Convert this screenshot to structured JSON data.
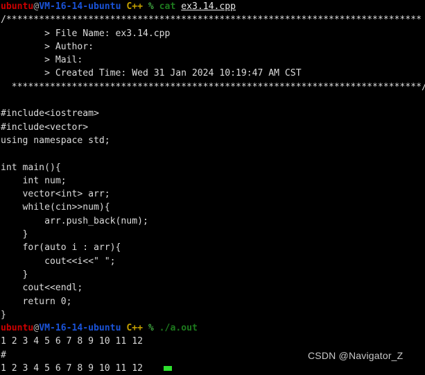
{
  "terminal": {
    "background_color": "#000000",
    "prompt": {
      "user": "ubuntu",
      "at": "@",
      "host": "VM-16-14-ubuntu",
      "dir": "C++",
      "symbol": "%"
    },
    "colors": {
      "user": "#cc0000",
      "host": "#1a53d8",
      "dir": "#c4a000",
      "percent": "#3fa33f",
      "command": "#1d7a1d",
      "output": "#d8d8d8",
      "cursor": "#2ee02e",
      "watermark": "#c9c9c9"
    },
    "command_1": "cat",
    "command_1_arg": "ex3.14.cpp",
    "command_2": "./a.out",
    "comment_banner_top": "/****************************************************************************",
    "comment_lines": [
      "        > File Name: ex3.14.cpp",
      "        > Author: ",
      "        > Mail: ",
      "        > Created Time: Wed 31 Jan 2024 10:19:47 AM CST"
    ],
    "comment_banner_bottom": "  ***************************************************************************/",
    "code_lines": [
      "#include<iostream>",
      "#include<vector>",
      "using namespace std;",
      "",
      "int main(){",
      "    int num;",
      "    vector<int> arr;",
      "    while(cin>>num){",
      "        arr.push_back(num);",
      "    }",
      "    for(auto i : arr){",
      "        cout<<i<<\" \";",
      "    }",
      "    cout<<endl;",
      "    return 0;",
      "}"
    ],
    "output_lines": [
      "1 2 3 4 5 6 7 8 9 10 11 12",
      "#",
      "1 2 3 4 5 6 7 8 9 10 11 12"
    ],
    "watermark": "CSDN @Navigator_Z"
  }
}
